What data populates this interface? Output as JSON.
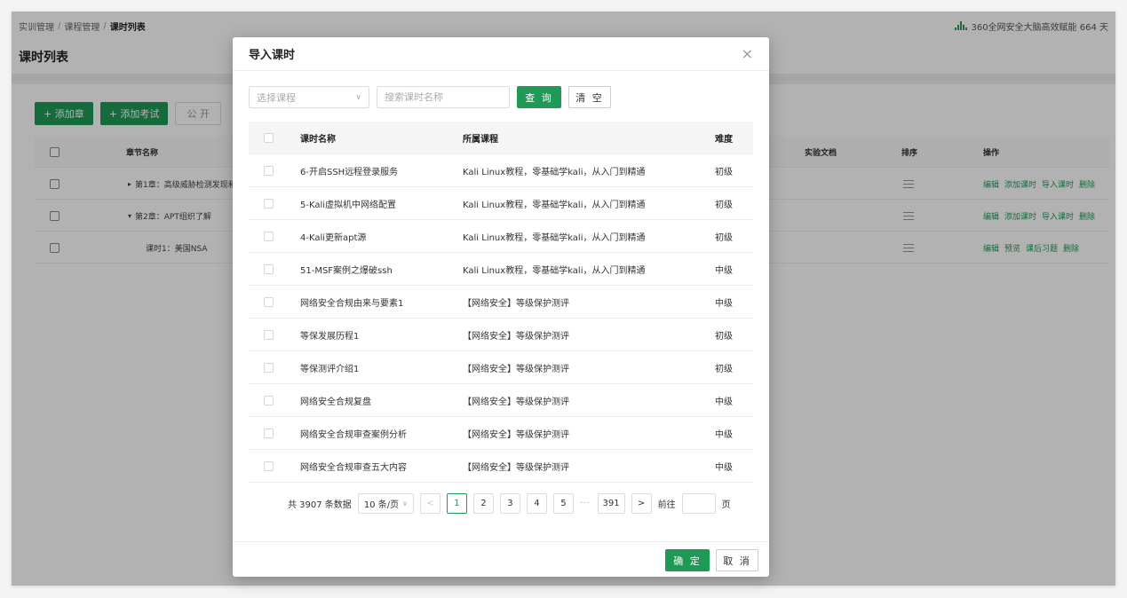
{
  "breadcrumb": [
    "实训管理",
    "课程管理",
    "课时列表"
  ],
  "breadcrumb_sep": "/",
  "topbar_right": "360全网安全大脑高效赋能 664 天",
  "page_title": "课时列表",
  "toolbar": {
    "add_chapter": "+ 添加章",
    "add_exam": "+ 添加考试",
    "public": "公 开"
  },
  "bg_table": {
    "headers": {
      "name": "章节名称",
      "doc": "实验文档",
      "sort": "排序",
      "ops": "操作"
    },
    "rows": [
      {
        "name": "第1章：高级威胁检测发现和",
        "ops": [
          "编辑",
          "添加课时",
          "导入课时",
          "删除"
        ]
      },
      {
        "name": "第2章：APT组织了解",
        "ops": [
          "编辑",
          "添加课时",
          "导入课时",
          "删除"
        ]
      },
      {
        "name": "课时1：美国NSA",
        "ops": [
          "编辑",
          "预览",
          "课后习题",
          "删除"
        ]
      }
    ]
  },
  "modal": {
    "title": "导入课时",
    "close_glyph": "×",
    "select_placeholder": "选择课程",
    "chevron_glyph": "∨",
    "search_placeholder": "搜索课时名称",
    "query_label": "查 询",
    "clear_label": "清 空",
    "headers": {
      "name": "课时名称",
      "course": "所属课程",
      "level": "难度"
    },
    "rows": [
      {
        "name": "6-开启SSH远程登录服务",
        "course": "Kali Linux教程，零基础学kali，从入门到精通",
        "level": "初级"
      },
      {
        "name": "5-Kali虚拟机中网络配置",
        "course": "Kali Linux教程，零基础学kali，从入门到精通",
        "level": "初级"
      },
      {
        "name": "4-Kali更新apt源",
        "course": "Kali Linux教程，零基础学kali，从入门到精通",
        "level": "初级"
      },
      {
        "name": "51-MSF案例之爆破ssh",
        "course": "Kali Linux教程，零基础学kali，从入门到精通",
        "level": "中级"
      },
      {
        "name": "网络安全合规由来与要素1",
        "course": "【网络安全】等级保护测评",
        "level": "中级"
      },
      {
        "name": "等保发展历程1",
        "course": "【网络安全】等级保护测评",
        "level": "初级"
      },
      {
        "name": "等保测评介绍1",
        "course": "【网络安全】等级保护测评",
        "level": "初级"
      },
      {
        "name": "网络安全合规复盘",
        "course": "【网络安全】等级保护测评",
        "level": "中级"
      },
      {
        "name": "网络安全合规审查案例分析",
        "course": "【网络安全】等级保护测评",
        "level": "中级"
      },
      {
        "name": "网络安全合规审查五大内容",
        "course": "【网络安全】等级保护测评",
        "level": "中级"
      }
    ],
    "pager": {
      "total": "共 3907 条数据",
      "page_size": "10 条/页",
      "prev_glyph": "<",
      "next_glyph": ">",
      "pages": [
        "1",
        "2",
        "3",
        "4",
        "5"
      ],
      "ellipsis": "···",
      "last_page": "391",
      "goto_label": "前往",
      "page_unit": "页"
    },
    "ok_label": "确 定",
    "cancel_label": "取 消"
  },
  "colors": {
    "accent": "#1f9a56"
  }
}
